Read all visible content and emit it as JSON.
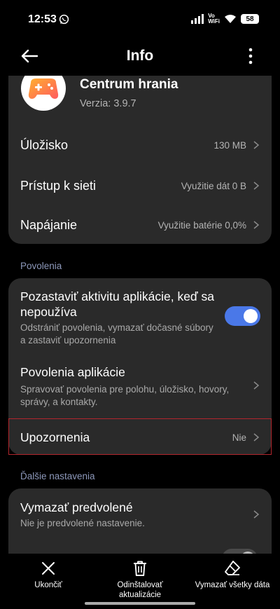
{
  "status_bar": {
    "time": "12:53",
    "vowifi_top": "Vo",
    "vowifi_bottom": "WiFi",
    "battery": "58"
  },
  "header": {
    "title": "Info",
    "back_icon": "arrow-left-icon",
    "more_icon": "more-vertical-icon"
  },
  "app": {
    "name": "Centrum hrania",
    "version": "Verzia: 3.9.7",
    "icon": "gamepad-icon"
  },
  "info_rows": [
    {
      "label": "Úložisko",
      "value": "130 MB"
    },
    {
      "label": "Prístup k sieti",
      "value": "Využitie dát 0 B"
    },
    {
      "label": "Napájanie",
      "value": "Využitie batérie 0,0%"
    }
  ],
  "permissions": {
    "section_title": "Povolenia",
    "pause_activity": {
      "label_line1": "Pozastaviť aktivitu aplikácie, keď sa",
      "label_line2": "nepoužíva",
      "sub_line1": "Odstrániť povolenia, vymazať dočasné súbory",
      "sub_line2": "a zastaviť upozornenia",
      "enabled": true
    },
    "app_permissions": {
      "label": "Povolenia aplikácie",
      "sub_line1": "Spravovať povolenia pre polohu, úložisko, hovory,",
      "sub_line2": "správy, a kontakty."
    },
    "notifications": {
      "label": "Upozornenia",
      "value": "Nie"
    }
  },
  "more_settings": {
    "section_title": "Ďalšie nastavenia",
    "clear_defaults": {
      "label": "Vymazať predvolené",
      "sub": "Nie je predvolené nastavenie."
    }
  },
  "bottom_actions": [
    {
      "label_line1": "Ukončiť",
      "label_line2": "",
      "icon": "close-icon"
    },
    {
      "label_line1": "Odinštalovať",
      "label_line2": "aktualizácie",
      "icon": "trash-icon"
    },
    {
      "label_line1": "Vymazať všetky dáta",
      "label_line2": "",
      "icon": "eraser-icon"
    }
  ],
  "colors": {
    "background": "#000000",
    "card": "#2a2a2a",
    "accent": "#4a78e8",
    "section_title": "#8d98ba",
    "highlight_border": "#b3262d"
  }
}
